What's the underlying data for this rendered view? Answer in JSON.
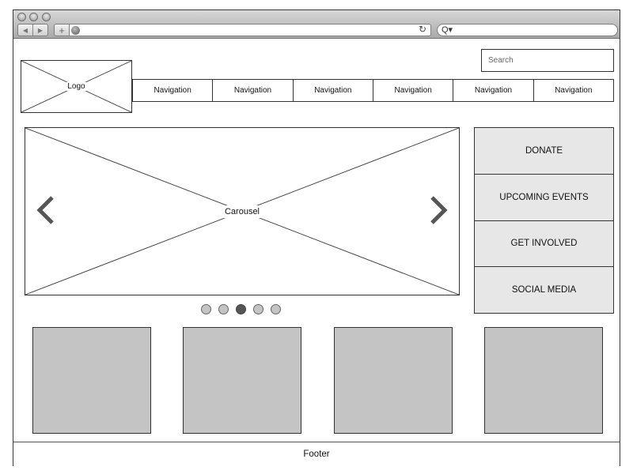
{
  "browser": {
    "window_controls": [
      "close",
      "minimize",
      "zoom"
    ],
    "back_icon": "back-arrow-icon",
    "forward_icon": "forward-arrow-icon",
    "new_tab_icon": "plus-icon",
    "new_tab_label": "+",
    "url": "",
    "reload_icon": "reload-icon",
    "reload_glyph": "↻",
    "search_value": "",
    "search_icon": "magnifier-icon",
    "search_glyph": "Q▾"
  },
  "header": {
    "logo_label": "Logo",
    "search_placeholder": "Search",
    "nav_items": [
      {
        "label": "Navigation"
      },
      {
        "label": "Navigation"
      },
      {
        "label": "Navigation"
      },
      {
        "label": "Navigation"
      },
      {
        "label": "Navigation"
      },
      {
        "label": "Navigation"
      }
    ]
  },
  "carousel": {
    "label": "Carousel",
    "prev_icon": "chevron-left-icon",
    "next_icon": "chevron-right-icon",
    "slide_count": 5,
    "active_slide": 3
  },
  "sidebar": {
    "buttons": [
      {
        "label": "DONATE"
      },
      {
        "label": "UPCOMING EVENTS"
      },
      {
        "label": "GET INVOLVED"
      },
      {
        "label": "SOCIAL MEDIA"
      }
    ]
  },
  "tiles": {
    "count": 4
  },
  "footer": {
    "label": "Footer"
  },
  "colors": {
    "placeholder_fill": "#c4c4c4",
    "sidebar_fill": "#e7e7e7",
    "active_dot": "#555555",
    "outline": "#333333"
  }
}
